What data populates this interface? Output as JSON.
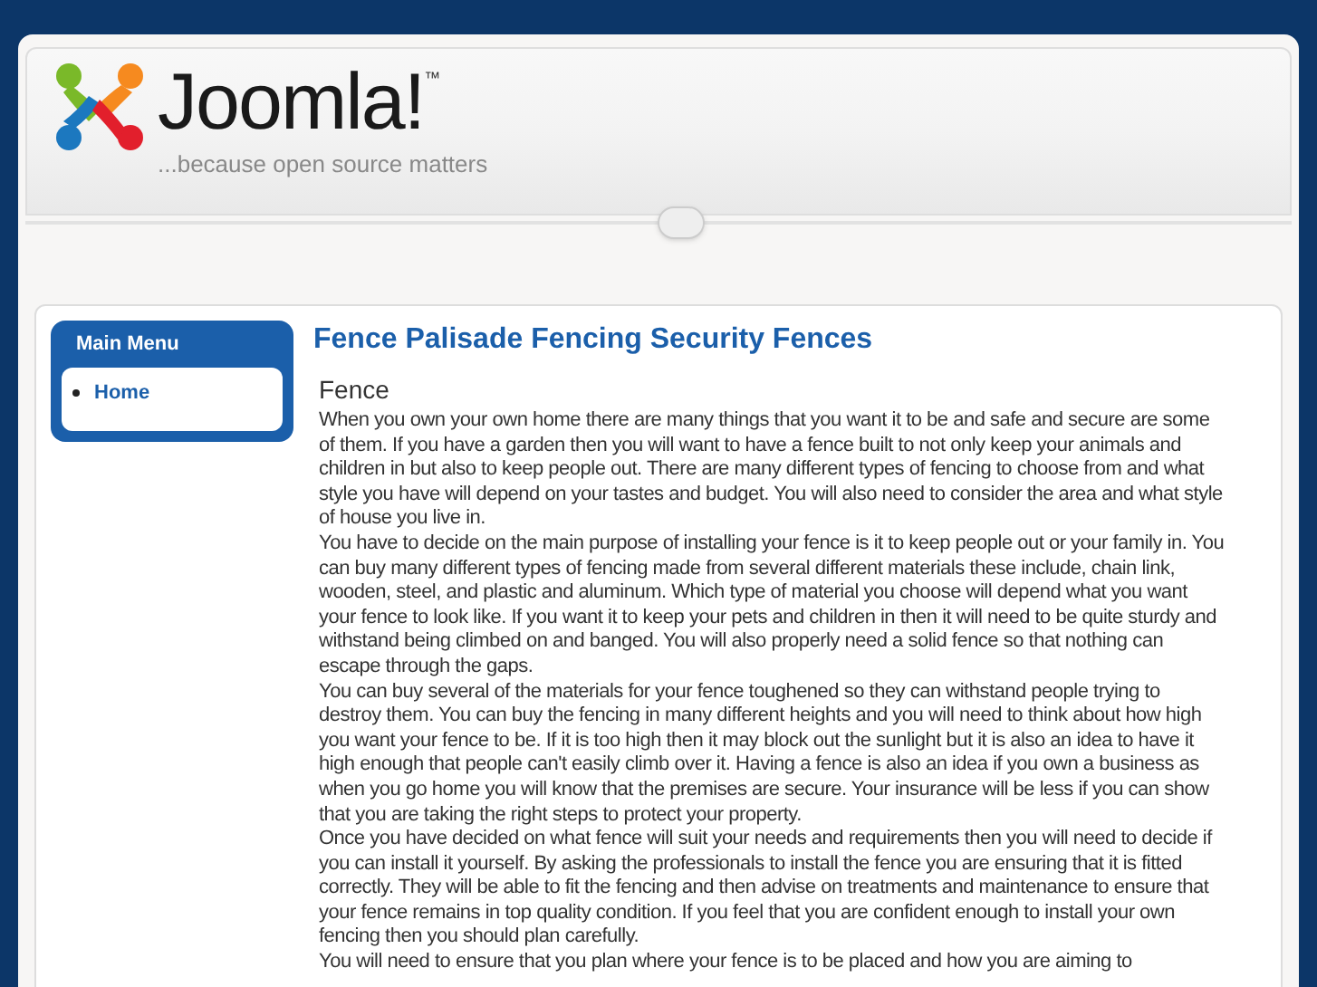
{
  "header": {
    "logo_text": "Joomla!",
    "trademark": "™",
    "tagline": "...because open source matters"
  },
  "main_menu": {
    "title": "Main Menu",
    "items": [
      {
        "label": "Home",
        "selected": true
      }
    ]
  },
  "article": {
    "title": "Fence Palisade Fencing Security Fences",
    "subtitle": "Fence",
    "paragraphs": [
      "When you own your own home there are many things that you want it to be and safe and secure are some of them. If you have a garden then you will want to have a fence built to not only keep your animals and children in but also to keep people out. There are many different types of fencing to choose from and what style you have will depend on your tastes and budget. You will also need to consider the area and what style of house you live in.",
      "You have to decide on the main purpose of installing your fence is it to keep people out or your family in. You can buy many different types of fencing made from several different materials these include, chain link, wooden, steel, and plastic and aluminum. Which type of material you choose will depend what you want your fence to look like. If you want it to keep your pets and children in then it will need to be quite sturdy and withstand being climbed on and banged. You will also properly need a solid fence so that nothing can escape through the gaps.",
      "You can buy several of the materials for your fence toughened so they can withstand people trying to destroy them. You can buy the fencing in many different heights and you will need to think about how high you want your fence to be. If it is too high then it may block out the sunlight but it is also an idea to have it high enough that people can't easily climb over it. Having a fence is also an idea if you own a business as when you go home you will know that the premises are secure. Your insurance will be less if you can show that you are taking the right steps to protect your property.",
      "Once you have decided on what fence will suit your needs and requirements then you will need to decide if you can install it yourself. By asking the professionals to install the fence you are ensuring that it is fitted correctly. They will be able to fit the fencing and then advise on treatments and maintenance to ensure that your fence remains in top quality condition. If you feel that you are confident enough to install your own fencing then you should plan carefully.",
      "You will need to ensure that you plan where your fence is to be placed and how you are aiming to"
    ]
  }
}
